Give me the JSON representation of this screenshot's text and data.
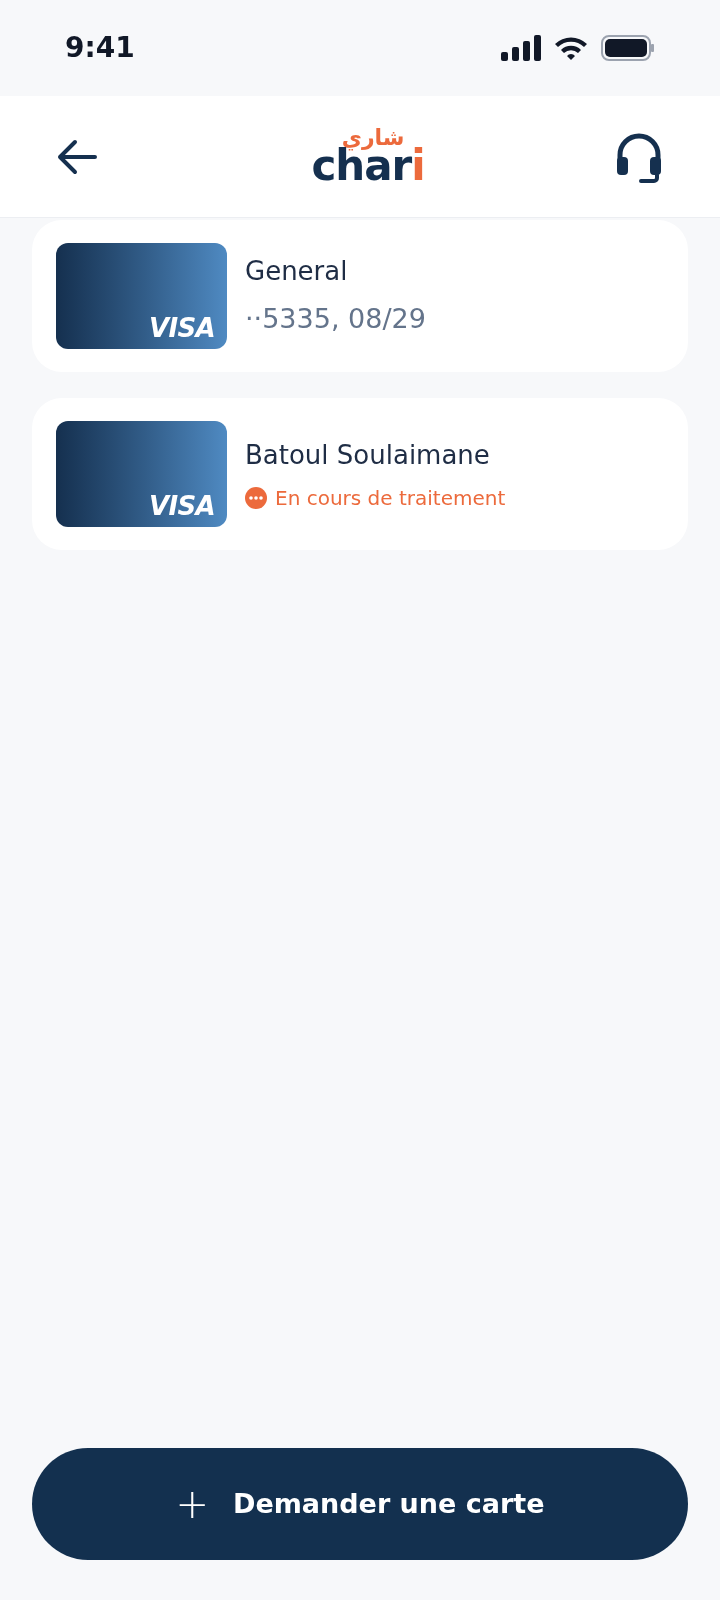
{
  "status_bar": {
    "time": "9:41"
  },
  "header": {
    "logo": {
      "main": "char",
      "accent": "i",
      "arabic": "شاري"
    }
  },
  "cards": [
    {
      "kind": "details",
      "brand": "VISA",
      "name": "General",
      "details": "··5335, 08/29"
    },
    {
      "kind": "status",
      "brand": "VISA",
      "name": "Batoul Soulaimane",
      "status": "En cours de traitement",
      "color": "#ec6a3c"
    }
  ],
  "action_button": {
    "icon": "+",
    "label": "Demander une carte"
  }
}
